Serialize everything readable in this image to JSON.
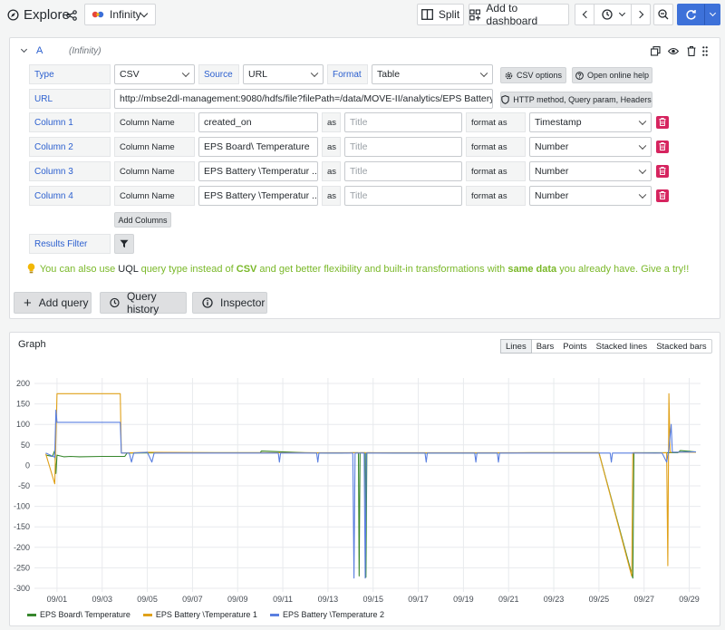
{
  "topbar": {
    "title": "Explore",
    "datasource": "Infinity",
    "split": "Split",
    "add_to_dashboard": "Add to dashboard"
  },
  "query": {
    "ref_id": "A",
    "ds_name": "(Infinity)",
    "type_label": "Type",
    "type_value": "CSV",
    "source_label": "Source",
    "source_value": "URL",
    "format_label": "Format",
    "format_value": "Table",
    "csv_options": "CSV options",
    "open_help": "Open online help",
    "url_label": "URL",
    "url_value": "http://mbse2dl-management:9080/hdfs/file?filePath=/data/MOVE-II/analytics/EPS Battery ...",
    "http_method_btn": "HTTP method, Query param, Headers",
    "column_name_label": "Column Name",
    "as_label": "as",
    "title_placeholder": "Title",
    "format_as_label": "format as",
    "columns": [
      {
        "label": "Column 1",
        "name": "created_on",
        "format": "Timestamp"
      },
      {
        "label": "Column 2",
        "name": "EPS Board\\ Temperature",
        "format": "Number"
      },
      {
        "label": "Column 3",
        "name": "EPS Battery \\Temperatur ...",
        "format": "Number"
      },
      {
        "label": "Column 4",
        "name": "EPS Battery \\Temperatur ...",
        "format": "Number"
      }
    ],
    "add_columns": "Add Columns",
    "results_filter": "Results Filter",
    "hint": {
      "p1": "You can also use ",
      "uql": "UQL",
      "p2": " query type instead of ",
      "csv": "CSV",
      "p3": " and get better flexibility and built-in transformations with ",
      "same": "same data",
      "p4": " you already have. Give a try!!"
    }
  },
  "actions": {
    "add_query": "Add query",
    "query_history": "Query history",
    "inspector": "Inspector"
  },
  "graph": {
    "title": "Graph",
    "tabs": [
      "Lines",
      "Bars",
      "Points",
      "Stacked lines",
      "Stacked bars"
    ],
    "active_tab": "Lines"
  },
  "chart_data": {
    "type": "line",
    "title": "Graph",
    "xlabel": "",
    "ylabel": "",
    "x_ticks": [
      "09/01",
      "09/03",
      "09/05",
      "09/07",
      "09/09",
      "09/11",
      "09/13",
      "09/15",
      "09/17",
      "09/19",
      "09/21",
      "09/23",
      "09/25",
      "09/27",
      "09/29"
    ],
    "y_ticks": [
      200,
      150,
      100,
      50,
      0,
      -50,
      -100,
      -150,
      -200,
      -250,
      -300
    ],
    "ylim": [
      -300,
      200
    ],
    "xlim": [
      0,
      29.5
    ],
    "grid": true,
    "legend_position": "bottom-left",
    "series": [
      {
        "name": "EPS Board\\ Temperature",
        "color": "#37872d",
        "points": [
          [
            0.5,
            25
          ],
          [
            0.8,
            22
          ],
          [
            0.9,
            36
          ],
          [
            0.95,
            -20
          ],
          [
            1.0,
            25
          ],
          [
            1.3,
            21
          ],
          [
            1.6,
            22
          ],
          [
            2.0,
            21
          ],
          [
            3.0,
            22
          ],
          [
            4.0,
            22
          ],
          [
            4.1,
            30
          ],
          [
            6.0,
            31
          ],
          [
            8.0,
            31
          ],
          [
            10.0,
            31
          ],
          [
            10.05,
            35
          ],
          [
            12.0,
            31
          ],
          [
            13.0,
            30
          ],
          [
            13.6,
            30
          ],
          [
            14.1,
            31
          ],
          [
            14.35,
            31
          ],
          [
            14.38,
            -270
          ],
          [
            14.42,
            31
          ],
          [
            14.65,
            31
          ],
          [
            14.68,
            -273
          ],
          [
            14.72,
            31
          ],
          [
            16.0,
            30
          ],
          [
            18.0,
            30
          ],
          [
            20.0,
            30
          ],
          [
            22.0,
            31
          ],
          [
            24.0,
            31
          ],
          [
            25.0,
            31
          ],
          [
            26.5,
            -275
          ],
          [
            26.55,
            31
          ],
          [
            27.5,
            31
          ],
          [
            28.5,
            31
          ],
          [
            28.6,
            36
          ],
          [
            29.3,
            33
          ]
        ]
      },
      {
        "name": "EPS Battery \\Temperature 1",
        "color": "#e0a11a",
        "points": [
          [
            0.5,
            28
          ],
          [
            0.9,
            -45
          ],
          [
            1.0,
            175
          ],
          [
            1.2,
            175
          ],
          [
            2.0,
            175
          ],
          [
            3.8,
            175
          ],
          [
            3.85,
            30
          ],
          [
            5.0,
            32
          ],
          [
            8.0,
            31
          ],
          [
            12.0,
            31
          ],
          [
            16.0,
            31
          ],
          [
            20.0,
            31
          ],
          [
            24.0,
            31
          ],
          [
            25.0,
            31
          ],
          [
            26.45,
            -270
          ],
          [
            26.5,
            31
          ],
          [
            27.5,
            30
          ],
          [
            28.0,
            31
          ],
          [
            28.05,
            -245
          ],
          [
            28.1,
            175
          ],
          [
            28.15,
            32
          ],
          [
            29.3,
            32
          ]
        ]
      },
      {
        "name": "EPS Battery \\Temperature 2",
        "color": "#5a7fe0",
        "points": [
          [
            0.5,
            30
          ],
          [
            0.9,
            20
          ],
          [
            0.95,
            135
          ],
          [
            1.0,
            105
          ],
          [
            2.0,
            105
          ],
          [
            3.8,
            105
          ],
          [
            3.85,
            30
          ],
          [
            4.2,
            30
          ],
          [
            4.3,
            8
          ],
          [
            4.4,
            30
          ],
          [
            5.0,
            32
          ],
          [
            5.2,
            8
          ],
          [
            5.3,
            30
          ],
          [
            6.0,
            30
          ],
          [
            8.0,
            30
          ],
          [
            10.0,
            30
          ],
          [
            10.8,
            30
          ],
          [
            10.85,
            8
          ],
          [
            10.9,
            30
          ],
          [
            12.5,
            30
          ],
          [
            12.55,
            8
          ],
          [
            12.6,
            30
          ],
          [
            14.1,
            30
          ],
          [
            14.15,
            -275
          ],
          [
            14.2,
            30
          ],
          [
            14.6,
            30
          ],
          [
            14.65,
            -275
          ],
          [
            14.7,
            30
          ],
          [
            16.0,
            30
          ],
          [
            17.3,
            30
          ],
          [
            17.35,
            8
          ],
          [
            17.4,
            30
          ],
          [
            19.5,
            30
          ],
          [
            19.55,
            8
          ],
          [
            19.6,
            30
          ],
          [
            20.5,
            30
          ],
          [
            20.55,
            8
          ],
          [
            20.6,
            30
          ],
          [
            22.0,
            30
          ],
          [
            24.0,
            30
          ],
          [
            25.0,
            30
          ],
          [
            25.5,
            30
          ],
          [
            25.55,
            8
          ],
          [
            25.6,
            30
          ],
          [
            27.8,
            30
          ],
          [
            28.0,
            8
          ],
          [
            28.1,
            40
          ],
          [
            28.2,
            100
          ],
          [
            28.25,
            32
          ],
          [
            29.3,
            33
          ]
        ]
      }
    ]
  }
}
